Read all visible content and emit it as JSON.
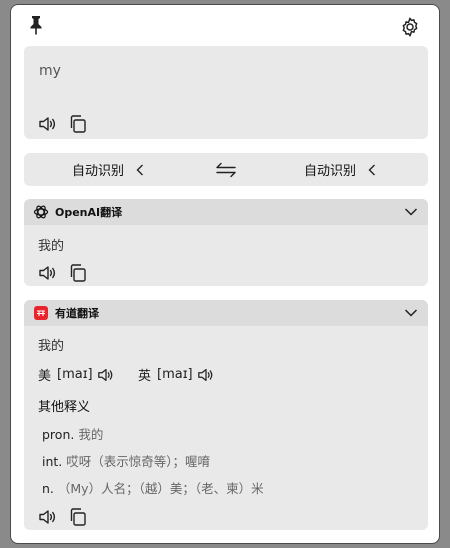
{
  "input": {
    "text": "my"
  },
  "languages": {
    "source": "自动识别",
    "target": "自动识别"
  },
  "openai": {
    "service_name": "OpenAI翻译",
    "result": "我的"
  },
  "youdao": {
    "service_name": "有道翻译",
    "result": "我的",
    "phonetics": [
      {
        "label": "美",
        "ipa": "[maɪ]"
      },
      {
        "label": "英",
        "ipa": "[maɪ]"
      }
    ],
    "other_meanings_title": "其他释义",
    "definitions": [
      {
        "pos": "pron.",
        "meaning": "我的"
      },
      {
        "pos": "int.",
        "meaning": "哎呀（表示惊奇等）；喔唷"
      },
      {
        "pos": "n.",
        "meaning": "（My）人名；（越）美；（老、柬）米"
      }
    ]
  },
  "colors": {
    "card_bg": "#e9e9e9",
    "header_bg": "#dcdcdc",
    "youdao_red": "#e8242c"
  }
}
